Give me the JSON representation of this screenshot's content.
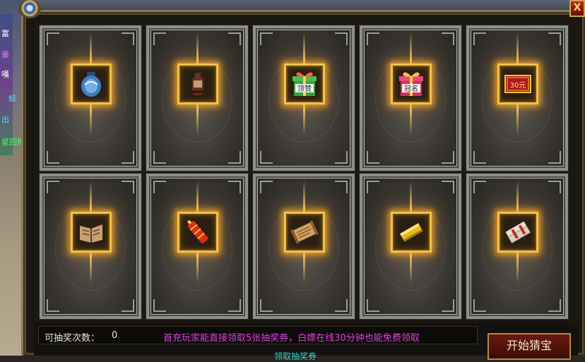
{
  "side_labels": [
    "富",
    "豪",
    "嘆",
    "蛙",
    "出",
    "星回购"
  ],
  "close_label": "X",
  "cards": [
    {
      "row": 0,
      "item": "blue-porcelain-jar"
    },
    {
      "row": 0,
      "item": "potion-bottle"
    },
    {
      "row": 0,
      "item": "gift-box-dingzan",
      "text": "顶赞"
    },
    {
      "row": 0,
      "item": "gift-box-guanming",
      "text": "冠名"
    },
    {
      "row": 0,
      "item": "red-voucher-30",
      "text": "30元"
    },
    {
      "row": 1,
      "item": "open-book"
    },
    {
      "row": 1,
      "item": "firecracker-scroll"
    },
    {
      "row": 1,
      "item": "parchment-scroll"
    },
    {
      "row": 1,
      "item": "gold-bar"
    },
    {
      "row": 1,
      "item": "paper-notes"
    }
  ],
  "bottom": {
    "draw_label": "可抽奖次数：",
    "draw_count": "0",
    "notice": "首充玩家能直接领取5张抽奖券，白嫖在线30分钟也能免费领取",
    "sub_link": "领取抽奖券",
    "start_button": "开始猜宝"
  },
  "colors": {
    "slot_glow": "#f2c24a",
    "notice": "#e040e0",
    "link": "#3ad0c8",
    "card_border": "#8d8e8e"
  }
}
